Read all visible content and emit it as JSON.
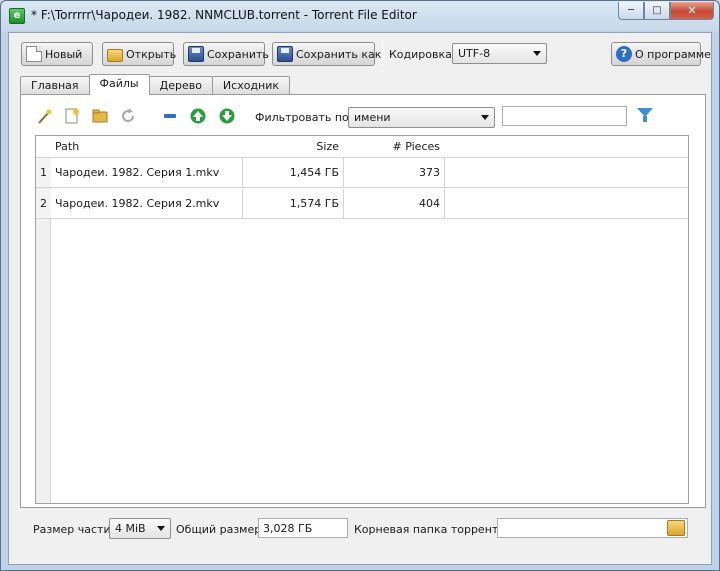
{
  "window": {
    "title": "* F:\\Torrrrr\\Чародеи. 1982. NNMCLUB.torrent - Torrent File Editor",
    "icon": "app-icon"
  },
  "toolbar": {
    "new_label": "Новый",
    "open_label": "Открыть",
    "save_label": "Сохранить",
    "save_as_label": "Сохранить как",
    "encoding_label": "Кодировка",
    "encoding_value": "UTF-8",
    "about_label": "О программе"
  },
  "tabs": [
    {
      "label": "Главная"
    },
    {
      "label": "Файлы"
    },
    {
      "label": "Дерево"
    },
    {
      "label": "Исходник"
    }
  ],
  "files_toolbar": {
    "filter_label": "Фильтровать по",
    "filter_by_value": "имени",
    "filter_text": ""
  },
  "table": {
    "columns": [
      "Path",
      "Size",
      "# Pieces"
    ],
    "rows": [
      {
        "num": "1",
        "path": "Чародеи. 1982. Серия 1.mkv",
        "size": "1,454 ГБ",
        "pieces": "373"
      },
      {
        "num": "2",
        "path": "Чародеи. 1982. Серия 2.mkv",
        "size": "1,574 ГБ",
        "pieces": "404"
      }
    ]
  },
  "bottom": {
    "piece_size_label": "Размер части",
    "piece_size_value": "4 MiB",
    "total_size_label": "Общий размер",
    "total_size_value": "3,028 ГБ",
    "root_folder_label": "Корневая папка торрента",
    "root_folder_value": ""
  },
  "colors": {
    "accent_blue": "#3d8ed8",
    "close_red": "#c74a35",
    "icon_green": "#2a9d3a"
  }
}
